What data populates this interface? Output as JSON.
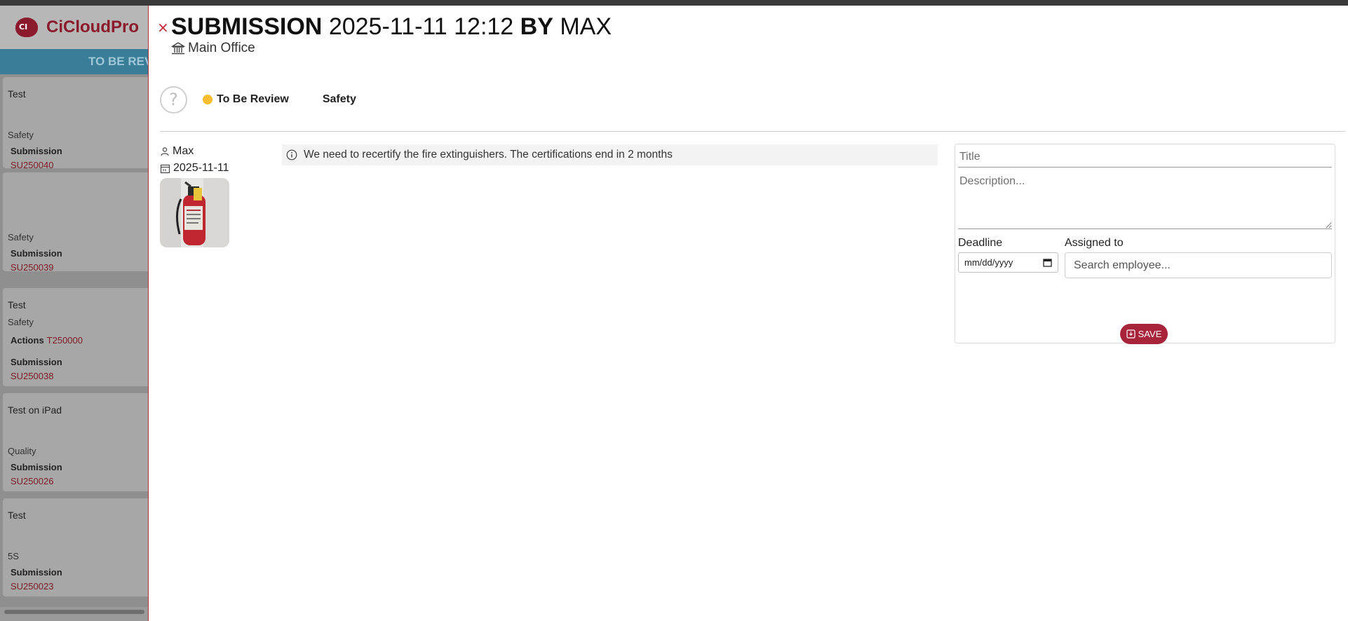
{
  "app": {
    "brand": "CiCloudPro",
    "logo_text": "CI",
    "column_title": "TO BE REVIEW"
  },
  "board_cards": [
    {
      "title": "Test",
      "category": "Safety",
      "submission_label": "Submission",
      "submission_ref": "SU250040"
    },
    {
      "title": "",
      "category": "Safety",
      "submission_label": "Submission",
      "submission_ref": "SU250039"
    },
    {
      "title": "Test",
      "category": "Safety",
      "actions_label": "Actions",
      "actions_ref": "T250000",
      "submission_label": "Submission",
      "submission_ref": "SU250038"
    },
    {
      "title": "Test on iPad",
      "category": "Quality",
      "submission_label": "Submission",
      "submission_ref": "SU250026"
    },
    {
      "title": "Test",
      "category": "5S",
      "submission_label": "Submission",
      "submission_ref": "SU250023"
    }
  ],
  "modal": {
    "close_symbol": "×",
    "title_word": "SUBMISSION",
    "title_datetime": "2025-11-11 12:12",
    "title_by": "BY",
    "title_author": "MAX",
    "office": "Main Office",
    "status": "To Be Review",
    "status_color": "#f7bd2d",
    "type": "Safety",
    "submitter": "Max",
    "submitted_date": "2025-11-11",
    "message": "We need to recertify the fire extinguishers. The certifications end in 2 months"
  },
  "action_form": {
    "title_placeholder": "Title",
    "description_placeholder": "Description...",
    "deadline_label": "Deadline",
    "deadline_placeholder": "mm/dd/yyyy",
    "assigned_label": "Assigned to",
    "assigned_placeholder": "Search employee...",
    "save_label": "SAVE",
    "accent_color": "#a8243a"
  }
}
